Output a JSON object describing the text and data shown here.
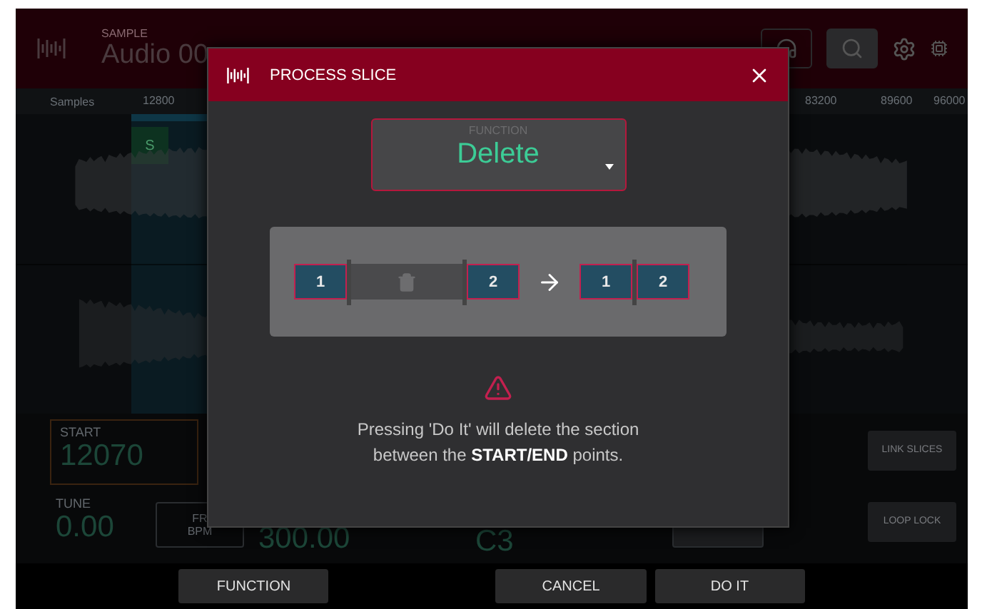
{
  "header": {
    "label": "SAMPLE",
    "title": "Audio 00"
  },
  "waveform": {
    "label": "Samples",
    "ruler": [
      "12800",
      "83200",
      "89600",
      "96000"
    ],
    "slice_marker": "S"
  },
  "params": {
    "start": {
      "label": "START",
      "value": "12070"
    },
    "tune": {
      "label": "TUNE",
      "value": "0.00"
    },
    "bpm_button": [
      "FR",
      "BPM"
    ],
    "bpm": "300.00",
    "note": "C3",
    "side_buttons": [
      "LINK SLICES",
      "LOOP LOCK"
    ]
  },
  "bottom_bar": {
    "left": [
      "FUNCTION"
    ],
    "right": [
      "CANCEL",
      "DO IT"
    ]
  },
  "dialog": {
    "title": "PROCESS SLICE",
    "function": {
      "label": "FUNCTION",
      "value": "Delete"
    },
    "diagram": {
      "before": [
        "1",
        "2"
      ],
      "after": [
        "1",
        "2"
      ]
    },
    "message": "Pressing 'Do It' will delete the section between the **START/END** points."
  }
}
